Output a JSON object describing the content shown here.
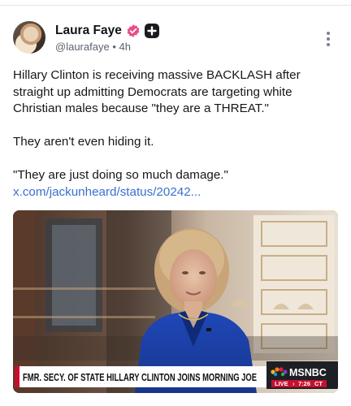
{
  "post": {
    "author": {
      "display_name": "Laura Faye",
      "handle": "@laurafaye",
      "separator": "•",
      "time": "4h"
    },
    "body": {
      "line1": "Hillary Clinton is receiving massive BACKLASH after",
      "line2": "straight up admitting Democrats are targeting white",
      "line3": "Christian males because \"they are a THREAT.\"",
      "line4": "They aren't even hiding it.",
      "line5": "\"They are just doing so much damage.\"",
      "link": "x.com/jackunheard/status/20242..."
    },
    "media": {
      "chyron": "FMR. SECY. OF STATE HILLARY CLINTON JOINS MORNING JOE",
      "network_logo": "MSNBC",
      "live_label": "LIVE",
      "live_time": "7:26",
      "live_time_suffix": "CT"
    }
  },
  "icons": {
    "verified": "verified-badge-icon",
    "plus": "plus-badge-icon",
    "more": "more-vertical-icon"
  },
  "colors": {
    "verified_pink": "#ea4c89",
    "link_blue": "#3a6fd1",
    "chyron_red": "#c8102e"
  }
}
